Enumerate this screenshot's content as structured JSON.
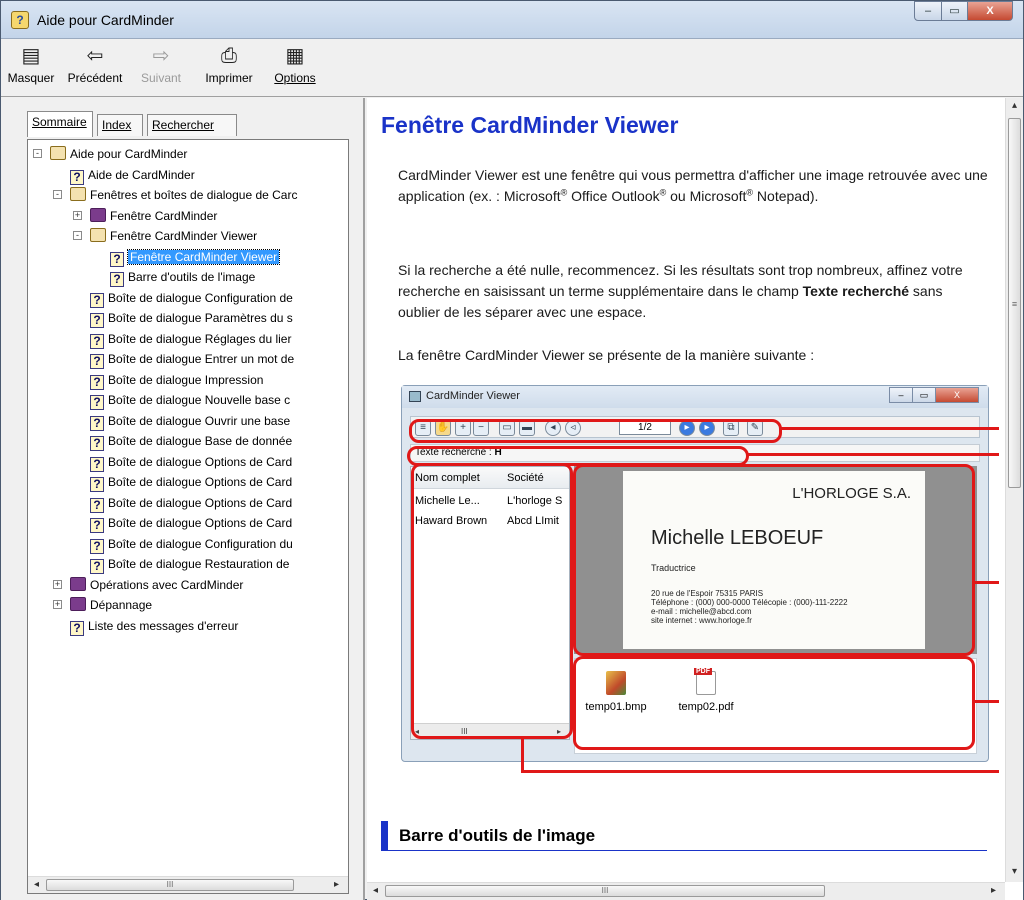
{
  "window": {
    "title": "Aide pour CardMinder",
    "controls": {
      "minimize": "–",
      "maximize": "▭",
      "close": "X"
    }
  },
  "toolbar": {
    "hide": "Masquer",
    "back": "Précédent",
    "forward": "Suivant",
    "print": "Imprimer",
    "options": "Options"
  },
  "tabs": {
    "contents": "Sommaire",
    "index": "Index",
    "search": "Rechercher"
  },
  "tree": [
    {
      "label": "Aide pour CardMinder",
      "kind": "book-open",
      "expander": "-"
    },
    {
      "label": "Aide de CardMinder",
      "kind": "topic"
    },
    {
      "label": "Fenêtres et boîtes de dialogue de Carc",
      "kind": "book-open",
      "expander": "-"
    },
    {
      "label": "Fenêtre CardMinder",
      "kind": "book-closed",
      "expander": "+"
    },
    {
      "label": "Fenêtre CardMinder Viewer",
      "kind": "book-open",
      "expander": "-"
    },
    {
      "label": "Fenêtre CardMinder Viewer",
      "kind": "topic",
      "selected": true
    },
    {
      "label": "Barre d'outils de l'image",
      "kind": "topic"
    },
    {
      "label": "Boîte de dialogue Configuration de",
      "kind": "topic"
    },
    {
      "label": "Boîte de dialogue Paramètres du s",
      "kind": "topic"
    },
    {
      "label": "Boîte de dialogue Réglages du lier",
      "kind": "topic"
    },
    {
      "label": "Boîte de dialogue Entrer un mot de",
      "kind": "topic"
    },
    {
      "label": "Boîte de dialogue Impression",
      "kind": "topic"
    },
    {
      "label": "Boîte de dialogue Nouvelle base c",
      "kind": "topic"
    },
    {
      "label": "Boîte de dialogue Ouvrir une base",
      "kind": "topic"
    },
    {
      "label": "Boîte de dialogue Base de donnée",
      "kind": "topic"
    },
    {
      "label": "Boîte de dialogue Options de Card",
      "kind": "topic"
    },
    {
      "label": "Boîte de dialogue Options de Card",
      "kind": "topic"
    },
    {
      "label": "Boîte de dialogue Options de Card",
      "kind": "topic"
    },
    {
      "label": "Boîte de dialogue Options de Card",
      "kind": "topic"
    },
    {
      "label": "Boîte de dialogue Configuration du",
      "kind": "topic"
    },
    {
      "label": "Boîte de dialogue Restauration de",
      "kind": "topic"
    },
    {
      "label": "Opérations avec CardMinder",
      "kind": "book-closed",
      "expander": "+"
    },
    {
      "label": "Dépannage",
      "kind": "book-closed",
      "expander": "+"
    },
    {
      "label": "Liste des messages d'erreur",
      "kind": "topic"
    }
  ],
  "scroll": {
    "left_arrow": "◂",
    "right_arrow": "▸",
    "up_arrow": "▴",
    "down_arrow": "▾",
    "thumb_grip": "III",
    "vthumb_grip": "≡"
  },
  "content": {
    "title": "Fenêtre CardMinder Viewer",
    "p1_a": "CardMinder Viewer est une fenêtre qui vous permettra d'afficher une image retrouvée avec une application (ex. : Microsoft",
    "p1_b": " Office Outlook",
    "p1_c": " ou Microsoft",
    "p1_d": " Notepad).",
    "reg": "®",
    "p2_a": "Si la recherche a été nulle, recommencez. Si les résultats sont trop nombreux, affinez votre recherche en saisissant un terme supplémentaire dans le champ ",
    "p2_bold": "Texte recherché",
    "p2_c": " sans oublier de les séparer avec une espace.",
    "p3": "La fenêtre CardMinder Viewer se présente de la manière suivante :",
    "section_heading": "Barre d'outils de l'image"
  },
  "screenshot": {
    "title": "CardMinder Viewer",
    "page_indicator": "1/2",
    "search_label": "Texte recherché :",
    "search_value": "H",
    "col_name": "Nom complet",
    "col_company": "Société",
    "rows": [
      {
        "name": "Michelle Le...",
        "company": "L'horloge S"
      },
      {
        "name": "Haward Brown",
        "company": "Abcd LImit"
      }
    ],
    "card": {
      "company": "L'HORLOGE S.A.",
      "name": "Michelle LEBOEUF",
      "role": "Traductrice",
      "address": "20 rue de l'Espoir 75315 PARIS",
      "phone": "Téléphone : (000) 000-0000   Télécopie : (000)-111-2222",
      "email": "e-mail : michelle@abcd.com",
      "site": "site internet : www.horloge.fr"
    },
    "files": [
      "temp01.bmp",
      "temp02.pdf"
    ],
    "file_badge": "PDF"
  },
  "colors": {
    "title_blue": "#1a33c8",
    "annotation_red": "#e01818",
    "selection": "#3399ff"
  }
}
